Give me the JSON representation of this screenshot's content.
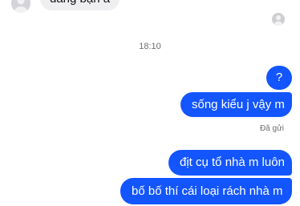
{
  "conversation": {
    "messages": [
      {
        "direction": "incoming",
        "text": "đang bận à"
      },
      {
        "direction": "outgoing",
        "text": "?"
      },
      {
        "direction": "outgoing",
        "text": "sống kiểu j vậy m"
      },
      {
        "direction": "outgoing",
        "text": "địt cụ tổ nhà m luôn"
      },
      {
        "direction": "outgoing",
        "text": "bố bố thí cái loại rách nhà m"
      }
    ],
    "timestamp": "18:10",
    "sent_status": "Đã gửi"
  },
  "icons": {
    "contact_avatar": "person-avatar-icon",
    "seen_avatar": "person-avatar-icon"
  },
  "colors": {
    "outgoing_bubble": "#1356ff",
    "incoming_bubble": "#efeff2",
    "outgoing_text": "#ffffff",
    "meta_text": "#6d6d72"
  }
}
